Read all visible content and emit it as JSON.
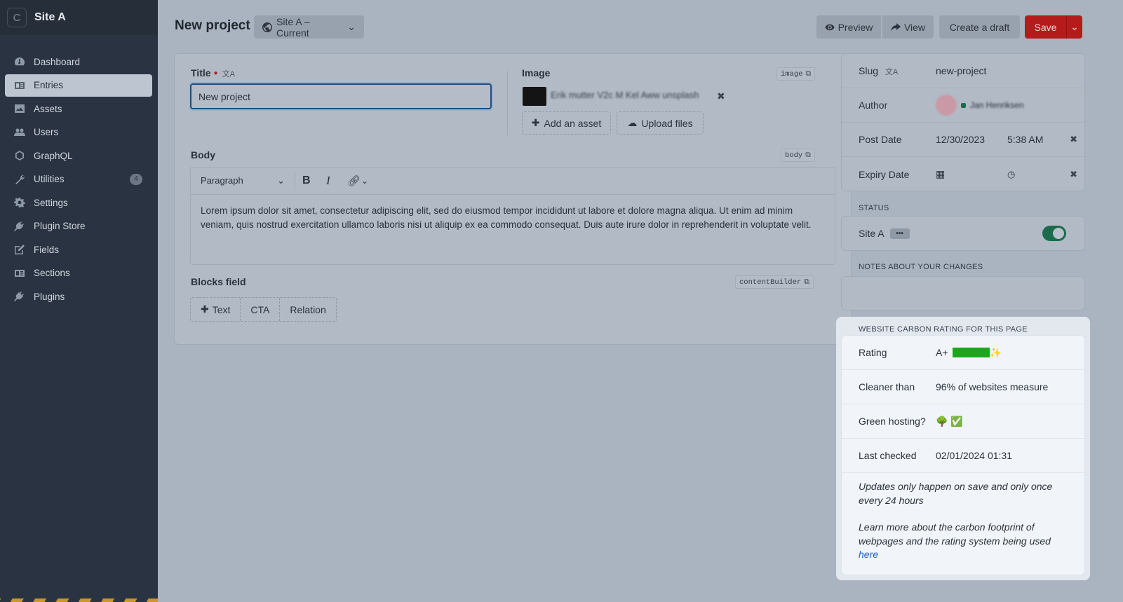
{
  "sidebar": {
    "logo": "C",
    "site_name": "Site A",
    "items": [
      {
        "label": "Dashboard",
        "icon": "dashboard-icon"
      },
      {
        "label": "Entries",
        "icon": "entries-icon",
        "active": true
      },
      {
        "label": "Assets",
        "icon": "assets-icon"
      },
      {
        "label": "Users",
        "icon": "users-icon"
      },
      {
        "label": "GraphQL",
        "icon": "graphql-icon"
      },
      {
        "label": "Utilities",
        "icon": "wrench-icon",
        "badge": "4"
      },
      {
        "label": "Settings",
        "icon": "gear-icon"
      },
      {
        "label": "Plugin Store",
        "icon": "plug-icon"
      },
      {
        "label": "Fields",
        "icon": "edit-icon"
      },
      {
        "label": "Sections",
        "icon": "sections-icon"
      },
      {
        "label": "Plugins",
        "icon": "plug-icon"
      }
    ]
  },
  "header": {
    "title": "New project",
    "site_select": "Site A – Current",
    "preview": "Preview",
    "view": "View",
    "create_draft": "Create a draft",
    "save": "Save"
  },
  "fields": {
    "title": {
      "label": "Title",
      "value": "New project"
    },
    "image": {
      "label": "Image",
      "handle": "image",
      "filename": "Erik mutter V2c M Kel Aww unsplash",
      "add_asset": "Add an asset",
      "upload": "Upload files"
    },
    "body": {
      "label": "Body",
      "handle": "body",
      "format": "Paragraph",
      "text": "Lorem ipsum dolor sit amet, consectetur adipiscing elit, sed do eiusmod tempor incididunt ut labore et dolore magna aliqua. Ut enim ad minim veniam, quis nostrud exercitation ullamco laboris nisi ut aliquip ex ea commodo consequat. Duis aute irure dolor in reprehenderit in voluptate velit."
    },
    "blocks": {
      "label": "Blocks field",
      "handle": "contentBuilder",
      "types": [
        "Text",
        "CTA",
        "Relation"
      ]
    }
  },
  "meta": {
    "slug_label": "Slug",
    "slug": "new-project",
    "author_label": "Author",
    "author_name": "Jan Henriksen",
    "post_date_label": "Post Date",
    "post_date": "12/30/2023",
    "post_time": "5:38 AM",
    "expiry_label": "Expiry Date"
  },
  "status": {
    "heading": "STATUS",
    "site": "Site A",
    "more": "•••",
    "enabled": true
  },
  "notes": {
    "heading": "NOTES ABOUT YOUR CHANGES",
    "value": ""
  },
  "carbon": {
    "heading": "WEBSITE CARBON RATING FOR THIS PAGE",
    "rating_label": "Rating",
    "rating": "A+",
    "rating_sparkle": "✨",
    "rating_bar_color": "#1da51d",
    "cleaner_label": "Cleaner than",
    "cleaner": "96% of websites measure",
    "green_label": "Green hosting?",
    "green": "🌳 ✅",
    "checked_label": "Last checked",
    "checked": "02/01/2024 01:31",
    "note1": "Updates only happen on save and only once every 24 hours",
    "note2": "Learn more about the carbon footprint of webpages and the rating system being used",
    "link": "here"
  },
  "colors": {
    "save": "#b41b1b",
    "accent": "#1d4e7e",
    "toggle_on": "#1b6b4c"
  }
}
